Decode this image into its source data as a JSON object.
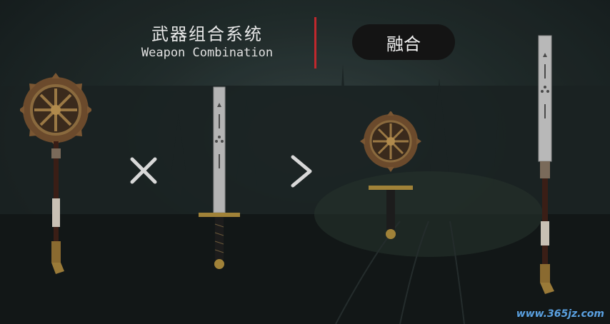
{
  "header": {
    "title_zh": "武器组合系统",
    "title_en": "Weapon Combination",
    "accent_color": "#c0282d"
  },
  "actions": {
    "fuse_label": "融合"
  },
  "operators": {
    "combine": "multiply-icon",
    "result": "chevron-right-icon"
  },
  "weapons": {
    "input_a": "sawblade-hammer-icon",
    "input_b": "straight-sword-icon",
    "result_hilt": "sawblade-hilt-icon",
    "result_blade": "long-blade-polearm-icon"
  },
  "watermark": "www.365jz.com"
}
